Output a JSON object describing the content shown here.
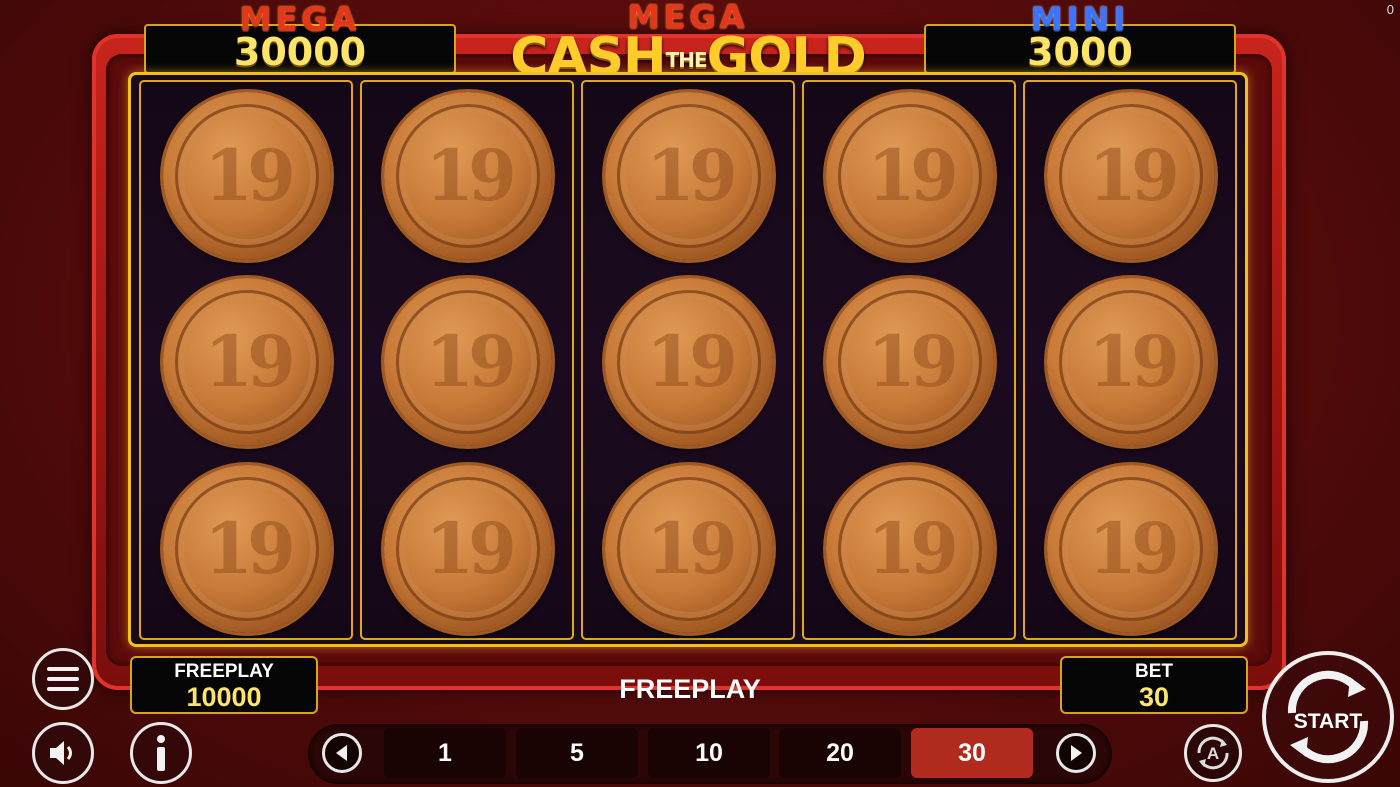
{
  "corner_counter": "0",
  "jackpots": {
    "left": {
      "title": "MEGA",
      "value": "30000"
    },
    "right": {
      "title": "MINI",
      "value": "3000"
    }
  },
  "logo": {
    "top": "MEGA",
    "part1": "CASH",
    "part2": "THE",
    "part3": "GOLD"
  },
  "reels": {
    "columns": 5,
    "rows": 3,
    "symbol": "copper-coin"
  },
  "coin_glyph": "19",
  "freeplay_box": {
    "label": "FREEPLAY",
    "value": "10000"
  },
  "status_text": "FREEPLAY",
  "bet_box": {
    "label": "BET",
    "value": "30"
  },
  "bet_options": [
    "1",
    "5",
    "10",
    "20",
    "30"
  ],
  "selected_bet": "30",
  "start_label": "START",
  "icons": {
    "menu": "menu-icon",
    "sound": "speaker-icon",
    "info": "info-icon",
    "autoplay": "autoplay-icon",
    "prev": "arrow-left-icon",
    "next": "arrow-right-icon"
  },
  "colors": {
    "accent_gold": "#f2c21a",
    "value_yellow": "#ffe46a",
    "active_bet": "#b02a1e"
  }
}
